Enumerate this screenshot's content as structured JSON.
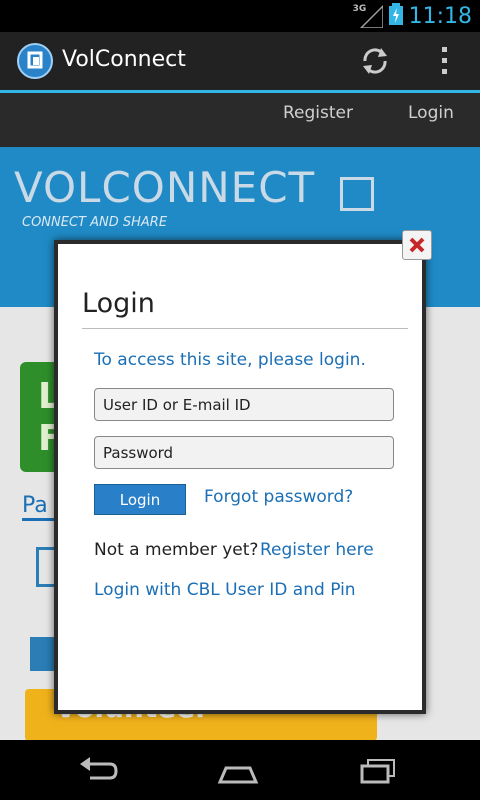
{
  "status_bar": {
    "network": "3G",
    "time": "11:18"
  },
  "app": {
    "title": "VolConnect",
    "accent": "#33b5e5"
  },
  "nav": {
    "register": "Register",
    "login": "Login"
  },
  "banner": {
    "title": "VOLCONNECT",
    "subtitle": "CONNECT AND SHARE",
    "color": "#1f8ac5"
  },
  "background": {
    "card_letters": "L\nF",
    "tab_partial": "Pa",
    "volunteer": "Volunteer"
  },
  "dialog": {
    "title": "Login",
    "info": "To access this site, please login.",
    "user_placeholder": "User ID or E-mail ID",
    "password_placeholder": "Password",
    "login_button": "Login",
    "forgot_link": "Forgot password?",
    "not_member": "Not a member yet?",
    "register_link": "Register here",
    "cbl_link": "Login with CBL User ID and Pin"
  },
  "icons": [
    "app-logo-icon",
    "refresh-icon",
    "overflow-menu-icon",
    "close-icon",
    "back-icon",
    "home-icon",
    "recent-apps-icon",
    "network-icon",
    "battery-icon"
  ]
}
